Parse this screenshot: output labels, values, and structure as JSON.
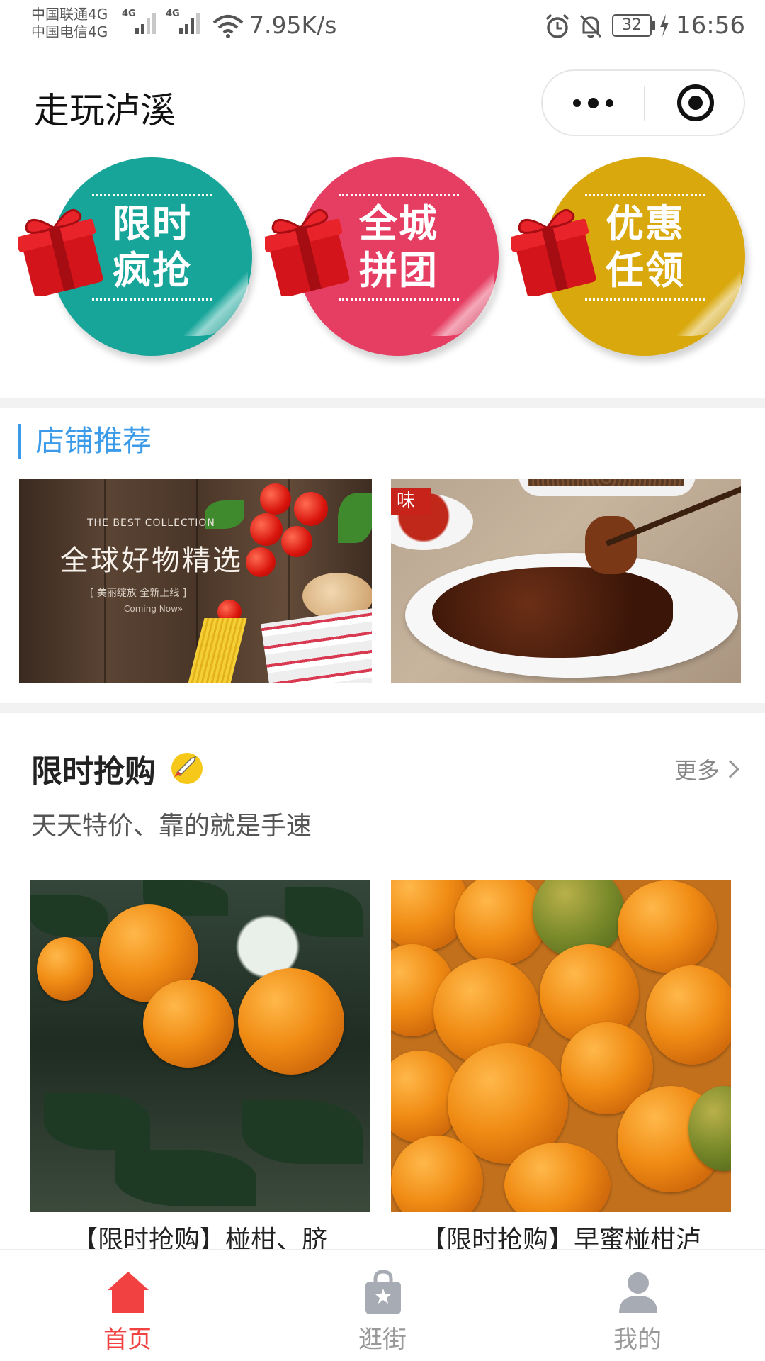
{
  "status_bar": {
    "carrier_1": "中国联通4G",
    "carrier_2": "中国电信4G",
    "signal_tag_1": "4G",
    "signal_tag_2": "4G",
    "net_speed": "7.95K/s",
    "battery": "32",
    "time": "16:56",
    "icons": [
      "signal-icon",
      "wifi-icon",
      "alarm-icon",
      "mute-icon",
      "battery-icon",
      "charging-icon"
    ]
  },
  "header": {
    "title": "走玩泸溪",
    "icons": [
      "more-icon",
      "close-target-icon"
    ]
  },
  "promos": [
    {
      "line1": "限时",
      "line2": "疯抢",
      "color": "#17a59a",
      "icon": "gift-icon"
    },
    {
      "line1": "全城",
      "line2": "拼团",
      "color": "#e63e62",
      "icon": "gift-icon"
    },
    {
      "line1": "优惠",
      "line2": "任领",
      "color": "#d9a80d",
      "icon": "gift-icon"
    }
  ],
  "stores": {
    "title": "店铺推荐",
    "accent": "#3b9be9",
    "banner_a": {
      "small": "THE BEST COLLECTION",
      "big": "全球好物精选",
      "tag": "[ 美丽绽放 全新上线 ]",
      "tag2": "Coming Now»"
    },
    "banner_b": {
      "sign": "味"
    }
  },
  "flash_sale": {
    "title": "限时抢购",
    "more": "更多",
    "subtitle": "天天特价、靠的就是手速",
    "products": [
      {
        "name": "【限时抢购】椪柑、脐"
      },
      {
        "name": "【限时抢购】早蜜椪柑泸"
      }
    ]
  },
  "tabbar": {
    "active_color": "#f14141",
    "items": [
      {
        "label": "首页",
        "icon": "home-icon",
        "active": true
      },
      {
        "label": "逛街",
        "icon": "shopping-bag-icon",
        "active": false
      },
      {
        "label": "我的",
        "icon": "user-icon",
        "active": false
      }
    ]
  }
}
